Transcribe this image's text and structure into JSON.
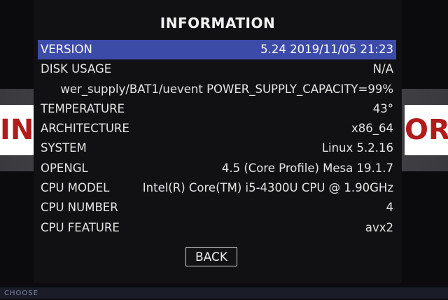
{
  "dialog": {
    "title": "INFORMATION",
    "back_label": "BACK",
    "selected_index": 0
  },
  "rows": [
    {
      "label": "VERSION",
      "value": "5.24 2019/11/05 21:23"
    },
    {
      "label": "DISK USAGE",
      "value": "N/A"
    },
    {
      "label": "",
      "value": "wer_supply/BAT1/uevent POWER_SUPPLY_CAPACITY=99%"
    },
    {
      "label": "TEMPERATURE",
      "value": "43°"
    },
    {
      "label": "ARCHITECTURE",
      "value": "x86_64"
    },
    {
      "label": "SYSTEM",
      "value": "Linux 5.2.16"
    },
    {
      "label": "OPENGL",
      "value": "4.5 (Core Profile) Mesa 19.1.7"
    },
    {
      "label": "CPU MODEL",
      "value": "Intel(R) Core(TM) i5-4300U CPU @ 1.90GHz"
    },
    {
      "label": "CPU NUMBER",
      "value": "4"
    },
    {
      "label": "CPU FEATURE",
      "value": "avx2"
    }
  ],
  "background": {
    "logo_left_text": "INTI",
    "logo_right_text": "ORI",
    "bottom_hint": "CHOOSE"
  },
  "colors": {
    "selection": "#3d4ba8",
    "dialog_bg": "#111113",
    "text": "#e4e4e4",
    "logo_red": "#b11b1b"
  }
}
